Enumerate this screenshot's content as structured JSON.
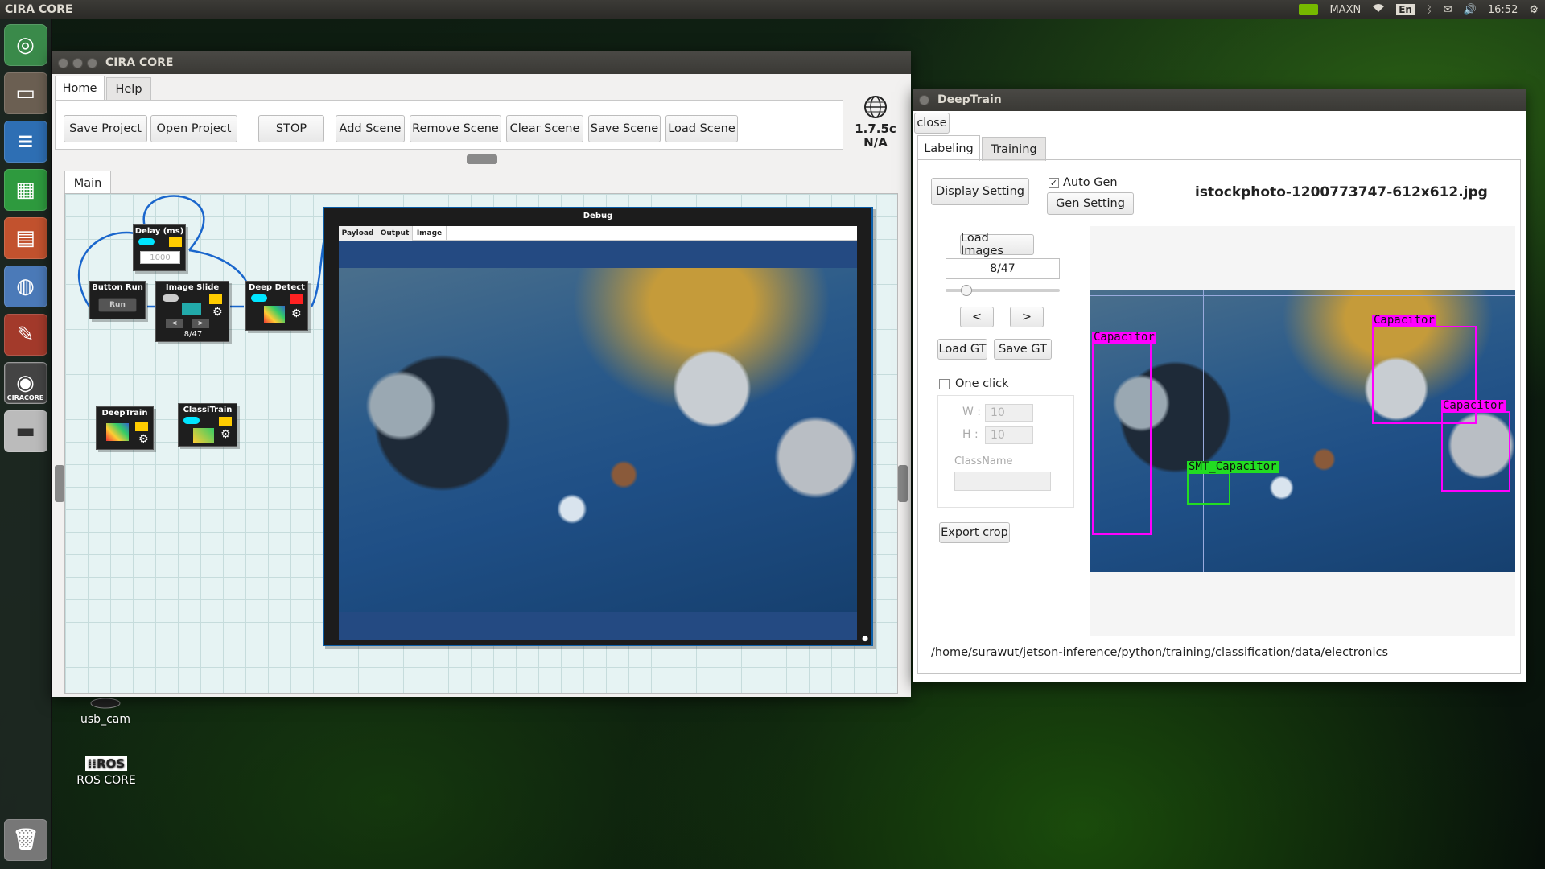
{
  "topbar": {
    "app_title": "CIRA CORE",
    "tray": {
      "maxn": "MAXN",
      "lang": "En",
      "time": "16:52"
    }
  },
  "launcher": {
    "cira_label": "CIRACORE"
  },
  "desktop": {
    "icons": [
      {
        "label": "usb_cam"
      },
      {
        "label": "ROS CORE",
        "logo_text": "⁞⁞ROS"
      }
    ]
  },
  "cira_window": {
    "title": "CIRA CORE",
    "menu_tabs": [
      "Home",
      "Help"
    ],
    "toolbar": {
      "save_project": "Save Project",
      "open_project": "Open Project",
      "stop": "STOP",
      "add_scene": "Add Scene",
      "remove_scene": "Remove Scene",
      "clear_scene": "Clear Scene",
      "save_scene": "Save Scene",
      "load_scene": "Load Scene"
    },
    "version": "1.7.5c",
    "version_status": "N/A",
    "scene_tab": "Main",
    "nodes": {
      "delay_title": "Delay (ms)",
      "delay_value": "1000",
      "button_run_title": "Button Run",
      "button_run_label": "Run",
      "image_slide_title": "Image Slide",
      "image_slide_counter": "8/47",
      "image_slide_prev": "<",
      "image_slide_next": ">",
      "deep_detect_title": "Deep Detect",
      "deeptrain_title": "DeepTrain",
      "classitrain_title": "ClassiTrain"
    },
    "debug": {
      "title": "Debug",
      "tabs": [
        "Payload",
        "Output",
        "Image"
      ],
      "active_tab": "Image"
    }
  },
  "deeptrain_window": {
    "title": "DeepTrain",
    "close_button": "close",
    "tabs": [
      "Labeling",
      "Training"
    ],
    "active_tab": "Labeling",
    "display_setting": "Display Setting",
    "auto_gen_label": "Auto Gen",
    "auto_gen_checked": true,
    "gen_setting": "Gen Setting",
    "image_name": "istockphoto-1200773747-612x612.jpg",
    "load_images": "Load Images",
    "image_counter": "8/47",
    "slider_position": 0.15,
    "prev_button": "<",
    "next_button": ">",
    "load_gt": "Load GT",
    "save_gt": "Save GT",
    "one_click_label": "One click",
    "one_click_checked": false,
    "w_label": "W :",
    "w_value": "10",
    "h_label": "H :",
    "h_value": "10",
    "classname_label": "ClassName",
    "classname_value": "",
    "export_crop": "Export crop",
    "detections": [
      {
        "label": "Capacitor",
        "color": "#ff00ff"
      },
      {
        "label": "Capacitor",
        "color": "#ff00ff"
      },
      {
        "label": "Capacitor",
        "color": "#ff00ff"
      },
      {
        "label": "SMT_Capacitor",
        "color": "#22dd22"
      }
    ],
    "data_path": "/home/surawut/jetson-inference/python/training/classification/data/electronics"
  }
}
